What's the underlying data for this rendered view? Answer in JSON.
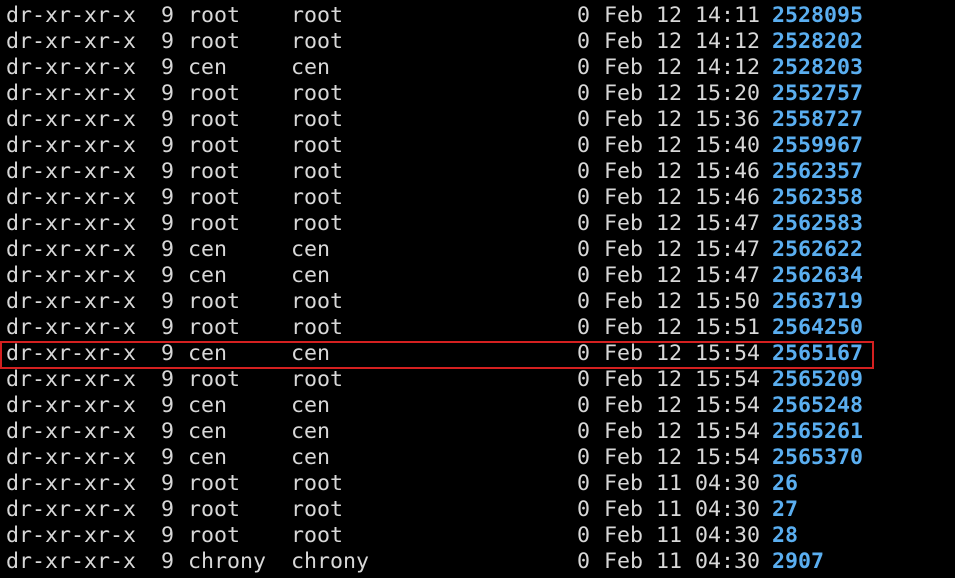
{
  "terminal": {
    "colors": {
      "background": "#000000",
      "text": "#d8d8d8",
      "directory": "#5aaef0",
      "highlight_border": "#d42020"
    },
    "highlighted_row_index": 13,
    "rows": [
      {
        "perms": "dr-xr-xr-x",
        "links": "9",
        "owner": "root",
        "group": "root",
        "size": "0",
        "month": "Feb",
        "day": "12",
        "time": "14:11",
        "name": "2528095"
      },
      {
        "perms": "dr-xr-xr-x",
        "links": "9",
        "owner": "root",
        "group": "root",
        "size": "0",
        "month": "Feb",
        "day": "12",
        "time": "14:12",
        "name": "2528202"
      },
      {
        "perms": "dr-xr-xr-x",
        "links": "9",
        "owner": "cen",
        "group": "cen",
        "size": "0",
        "month": "Feb",
        "day": "12",
        "time": "14:12",
        "name": "2528203"
      },
      {
        "perms": "dr-xr-xr-x",
        "links": "9",
        "owner": "root",
        "group": "root",
        "size": "0",
        "month": "Feb",
        "day": "12",
        "time": "15:20",
        "name": "2552757"
      },
      {
        "perms": "dr-xr-xr-x",
        "links": "9",
        "owner": "root",
        "group": "root",
        "size": "0",
        "month": "Feb",
        "day": "12",
        "time": "15:36",
        "name": "2558727"
      },
      {
        "perms": "dr-xr-xr-x",
        "links": "9",
        "owner": "root",
        "group": "root",
        "size": "0",
        "month": "Feb",
        "day": "12",
        "time": "15:40",
        "name": "2559967"
      },
      {
        "perms": "dr-xr-xr-x",
        "links": "9",
        "owner": "root",
        "group": "root",
        "size": "0",
        "month": "Feb",
        "day": "12",
        "time": "15:46",
        "name": "2562357"
      },
      {
        "perms": "dr-xr-xr-x",
        "links": "9",
        "owner": "root",
        "group": "root",
        "size": "0",
        "month": "Feb",
        "day": "12",
        "time": "15:46",
        "name": "2562358"
      },
      {
        "perms": "dr-xr-xr-x",
        "links": "9",
        "owner": "root",
        "group": "root",
        "size": "0",
        "month": "Feb",
        "day": "12",
        "time": "15:47",
        "name": "2562583"
      },
      {
        "perms": "dr-xr-xr-x",
        "links": "9",
        "owner": "cen",
        "group": "cen",
        "size": "0",
        "month": "Feb",
        "day": "12",
        "time": "15:47",
        "name": "2562622"
      },
      {
        "perms": "dr-xr-xr-x",
        "links": "9",
        "owner": "cen",
        "group": "cen",
        "size": "0",
        "month": "Feb",
        "day": "12",
        "time": "15:47",
        "name": "2562634"
      },
      {
        "perms": "dr-xr-xr-x",
        "links": "9",
        "owner": "root",
        "group": "root",
        "size": "0",
        "month": "Feb",
        "day": "12",
        "time": "15:50",
        "name": "2563719"
      },
      {
        "perms": "dr-xr-xr-x",
        "links": "9",
        "owner": "root",
        "group": "root",
        "size": "0",
        "month": "Feb",
        "day": "12",
        "time": "15:51",
        "name": "2564250"
      },
      {
        "perms": "dr-xr-xr-x",
        "links": "9",
        "owner": "cen",
        "group": "cen",
        "size": "0",
        "month": "Feb",
        "day": "12",
        "time": "15:54",
        "name": "2565167"
      },
      {
        "perms": "dr-xr-xr-x",
        "links": "9",
        "owner": "root",
        "group": "root",
        "size": "0",
        "month": "Feb",
        "day": "12",
        "time": "15:54",
        "name": "2565209"
      },
      {
        "perms": "dr-xr-xr-x",
        "links": "9",
        "owner": "cen",
        "group": "cen",
        "size": "0",
        "month": "Feb",
        "day": "12",
        "time": "15:54",
        "name": "2565248"
      },
      {
        "perms": "dr-xr-xr-x",
        "links": "9",
        "owner": "cen",
        "group": "cen",
        "size": "0",
        "month": "Feb",
        "day": "12",
        "time": "15:54",
        "name": "2565261"
      },
      {
        "perms": "dr-xr-xr-x",
        "links": "9",
        "owner": "cen",
        "group": "cen",
        "size": "0",
        "month": "Feb",
        "day": "12",
        "time": "15:54",
        "name": "2565370"
      },
      {
        "perms": "dr-xr-xr-x",
        "links": "9",
        "owner": "root",
        "group": "root",
        "size": "0",
        "month": "Feb",
        "day": "11",
        "time": "04:30",
        "name": "26"
      },
      {
        "perms": "dr-xr-xr-x",
        "links": "9",
        "owner": "root",
        "group": "root",
        "size": "0",
        "month": "Feb",
        "day": "11",
        "time": "04:30",
        "name": "27"
      },
      {
        "perms": "dr-xr-xr-x",
        "links": "9",
        "owner": "root",
        "group": "root",
        "size": "0",
        "month": "Feb",
        "day": "11",
        "time": "04:30",
        "name": "28"
      },
      {
        "perms": "dr-xr-xr-x",
        "links": "9",
        "owner": "chrony",
        "group": "chrony",
        "size": "0",
        "month": "Feb",
        "day": "11",
        "time": "04:30",
        "name": "2907"
      }
    ]
  }
}
